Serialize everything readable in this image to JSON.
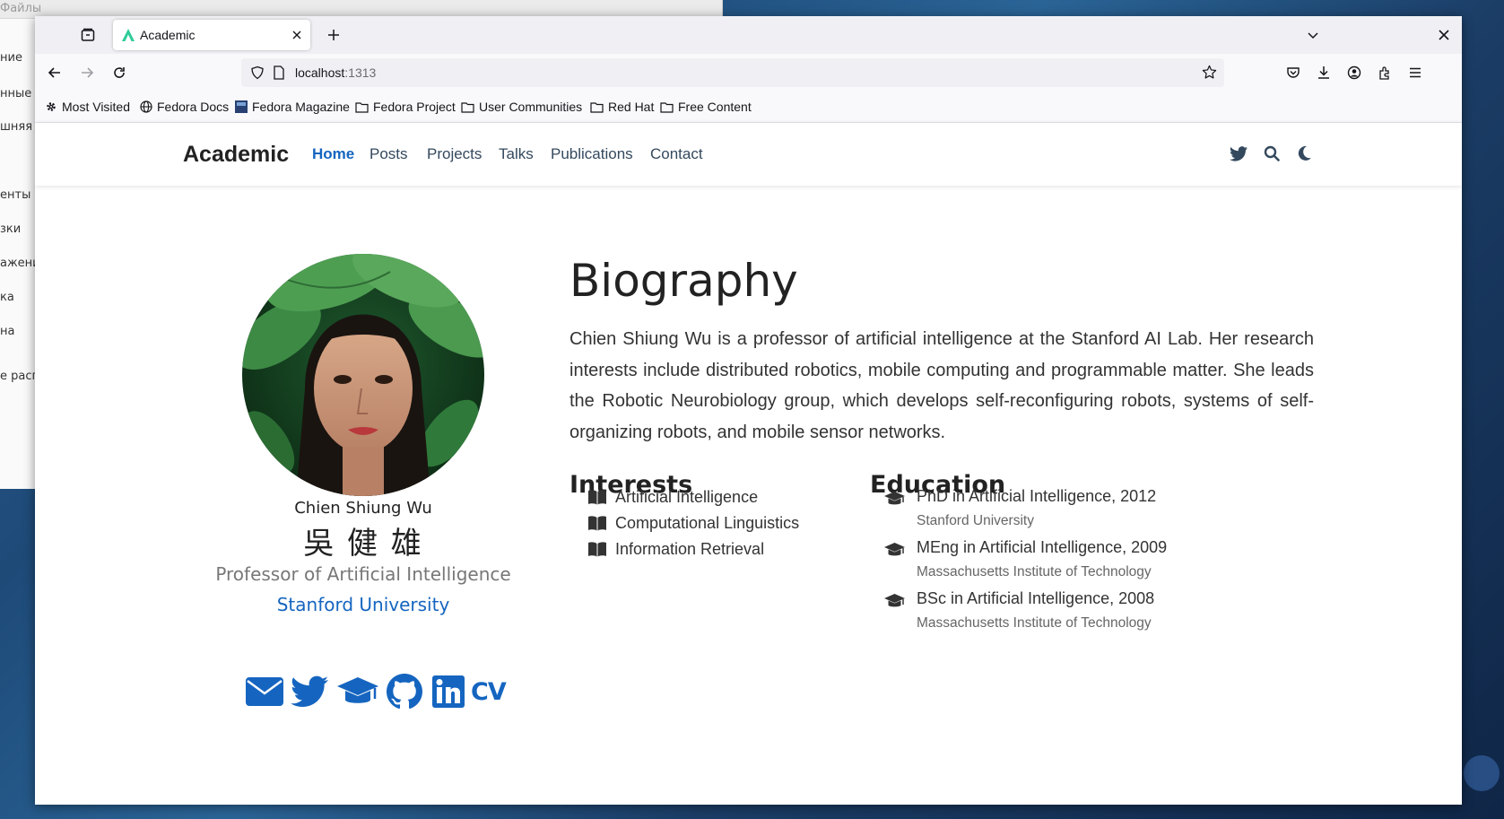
{
  "background_window": {
    "title": "Файлы",
    "items": [
      "ние",
      "нные",
      "шняя п",
      "енты",
      "зки",
      "ажени",
      "ка",
      "на",
      "е расп"
    ]
  },
  "browser": {
    "tab_title": "Academic",
    "url_host": "localhost",
    "url_port": ":1313",
    "bookmarks": [
      "Most Visited",
      "Fedora Docs",
      "Fedora Magazine",
      "Fedora Project",
      "User Communities",
      "Red Hat",
      "Free Content"
    ]
  },
  "site": {
    "brand": "Academic",
    "menu": [
      "Home",
      "Posts",
      "Projects",
      "Talks",
      "Publications",
      "Contact"
    ],
    "active_menu": "Home",
    "accent_color": "#1565c0"
  },
  "profile": {
    "name": "Chien Shiung Wu",
    "name_cjk": "吳 健 雄",
    "role": "Professor of Artificial Intelligence",
    "organization": "Stanford University",
    "social_icons": [
      "envelope-icon",
      "twitter-icon",
      "graduation-cap-icon",
      "github-icon",
      "linkedin-icon",
      "cv-icon"
    ],
    "cv_label": "CV"
  },
  "biography": {
    "heading": "Biography",
    "text": "Chien Shiung Wu is a professor of artificial intelligence at the Stanford AI Lab. Her research interests include distributed robotics, mobile computing and programmable matter. She leads the Robotic Neurobiology group, which develops self-reconfiguring robots, systems of self-organizing robots, and mobile sensor networks."
  },
  "interests": {
    "heading": "Interests",
    "items": [
      "Artificial Intelligence",
      "Computational Linguistics",
      "Information Retrieval"
    ]
  },
  "education": {
    "heading": "Education",
    "items": [
      {
        "degree": "PhD in Artificial Intelligence, 2012",
        "institution": "Stanford University"
      },
      {
        "degree": "MEng in Artificial Intelligence, 2009",
        "institution": "Massachusetts Institute of Technology"
      },
      {
        "degree": "BSc in Artificial Intelligence, 2008",
        "institution": "Massachusetts Institute of Technology"
      }
    ]
  }
}
